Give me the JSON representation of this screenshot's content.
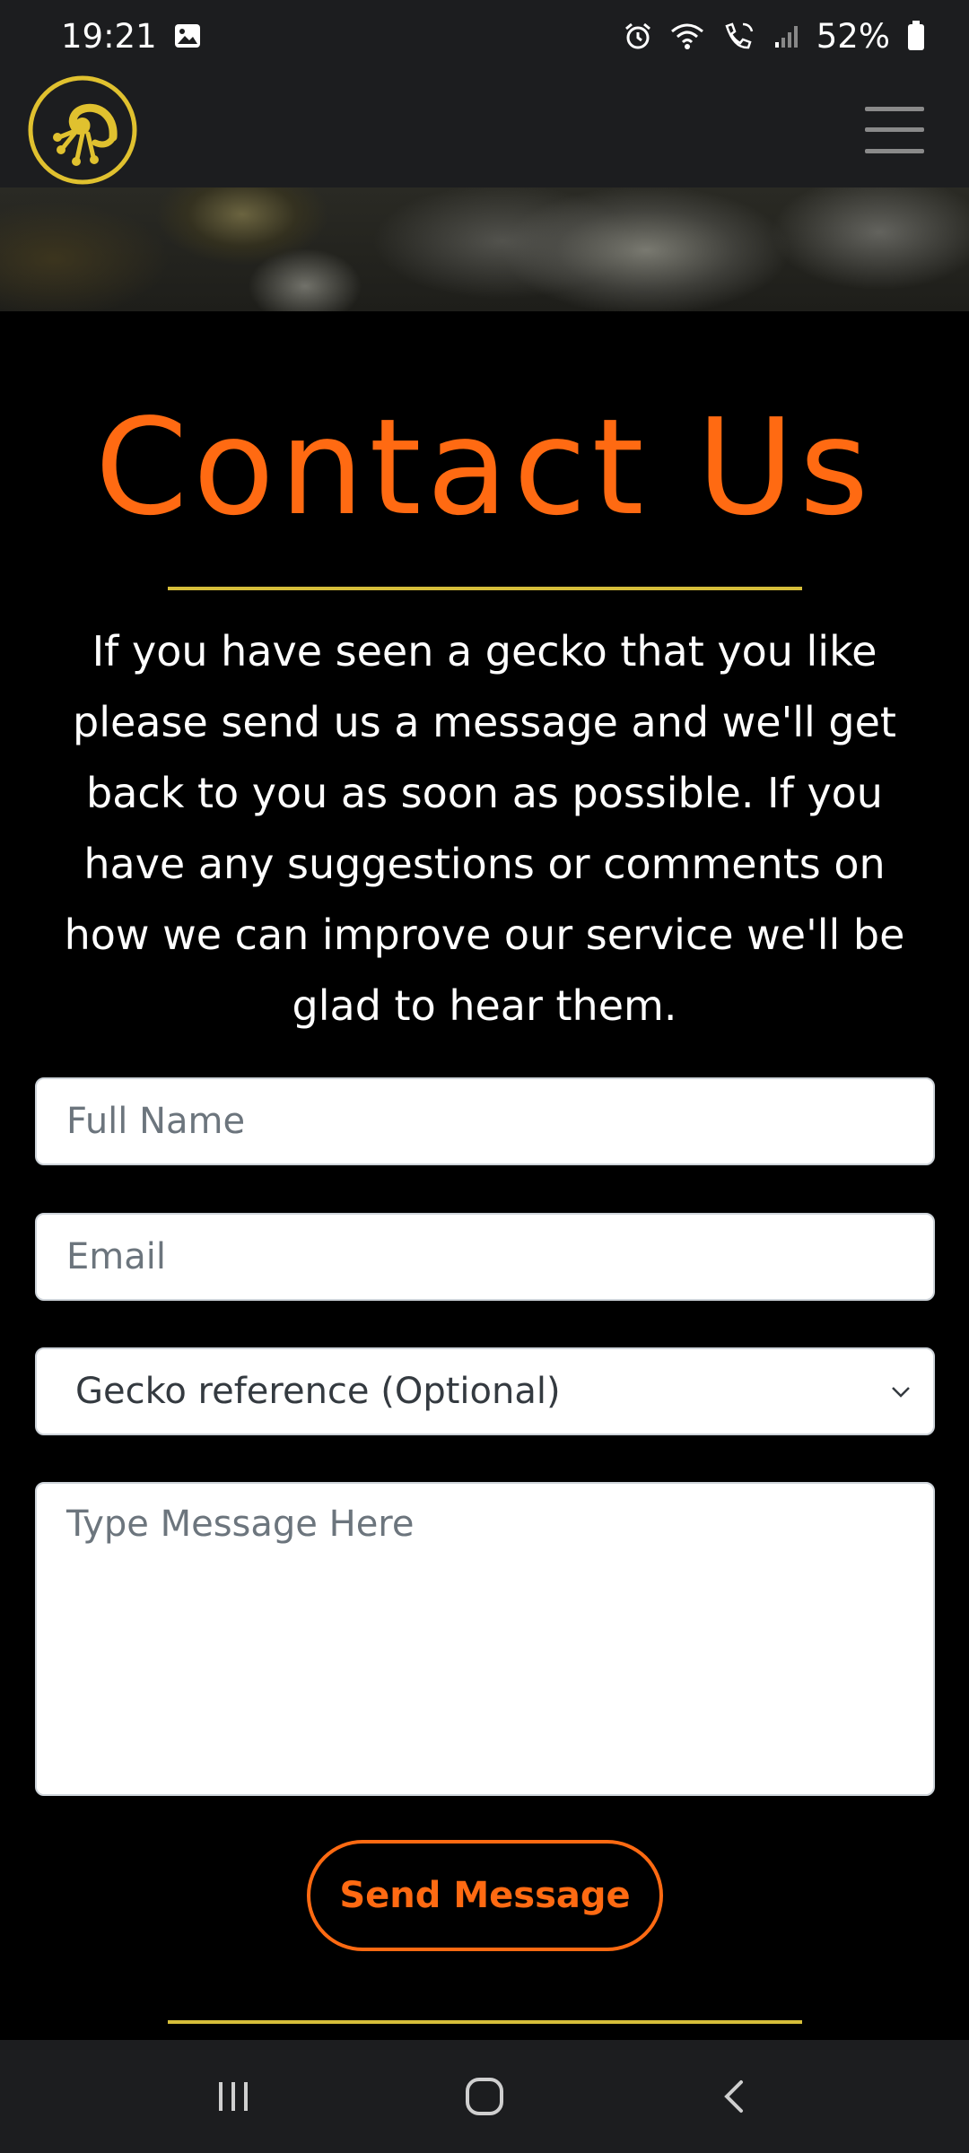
{
  "status_bar": {
    "time": "19:21",
    "battery": "52%",
    "icons": [
      "image-icon",
      "alarm-icon",
      "wifi-icon",
      "wifi-calling-icon",
      "signal-icon",
      "battery-icon"
    ]
  },
  "navbar": {
    "logo_icon": "gecko-logo-icon",
    "menu_icon": "hamburger-menu-icon"
  },
  "contact": {
    "title": "Contact Us",
    "intro": "If you have seen a gecko that you like please send us a message and we'll get back to you as soon as possible. If you have any suggestions or comments on how we can improve our service we'll be glad to hear them."
  },
  "form": {
    "name_placeholder": "Full Name",
    "email_placeholder": "Email",
    "gecko_select_value": "Gecko reference (Optional)",
    "message_placeholder": "Type Message Here",
    "submit_label": "Send Message"
  },
  "nav_bar": {
    "icons": [
      "recent-apps-icon",
      "home-icon",
      "back-icon"
    ]
  },
  "colors": {
    "accent": "#ff6a12",
    "divider": "#d6be3a",
    "logo": "#e0c12f",
    "bar_bg": "#1c1d1f"
  }
}
